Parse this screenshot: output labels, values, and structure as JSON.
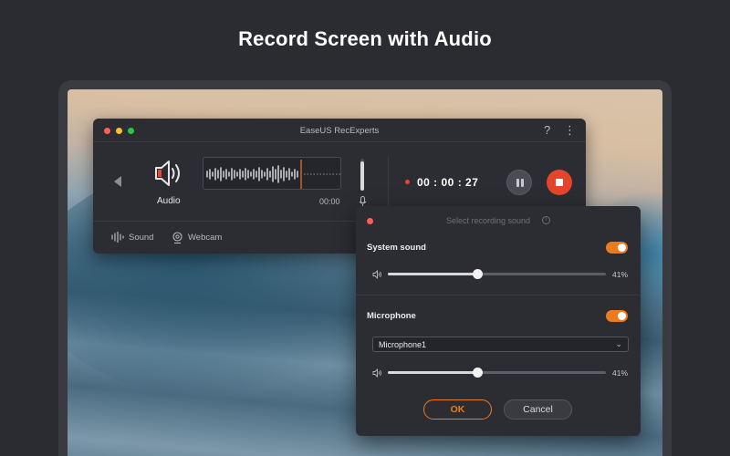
{
  "headline": "Record Screen with Audio",
  "recorder": {
    "title": "EaseUS RecExperts",
    "help_icon": "?",
    "more_icon": "⋮",
    "audio_label": "Audio",
    "wave_time": "00:00",
    "timer": "00 : 00 : 27",
    "footer": {
      "sound_label": "Sound",
      "webcam_label": "Webcam"
    }
  },
  "sound_panel": {
    "title": "Select recording sound",
    "info_icon": "i",
    "system_sound": {
      "label": "System sound",
      "enabled": true,
      "volume_pct": "41%",
      "volume": 0.41
    },
    "microphone": {
      "label": "Microphone",
      "enabled": true,
      "device": "Microphone1",
      "volume_pct": "41%",
      "volume": 0.41
    },
    "ok_label": "OK",
    "cancel_label": "Cancel"
  },
  "colors": {
    "accent": "#ee7a1f",
    "stop": "#e5452d",
    "rec_dot": "#e8452f"
  },
  "icons": [
    "speaker-icon",
    "back-arrow-icon",
    "mic-icon",
    "pause-icon",
    "stop-icon",
    "sound-wave-icon",
    "webcam-icon",
    "info-icon",
    "chevron-down-icon",
    "volume-icon"
  ]
}
